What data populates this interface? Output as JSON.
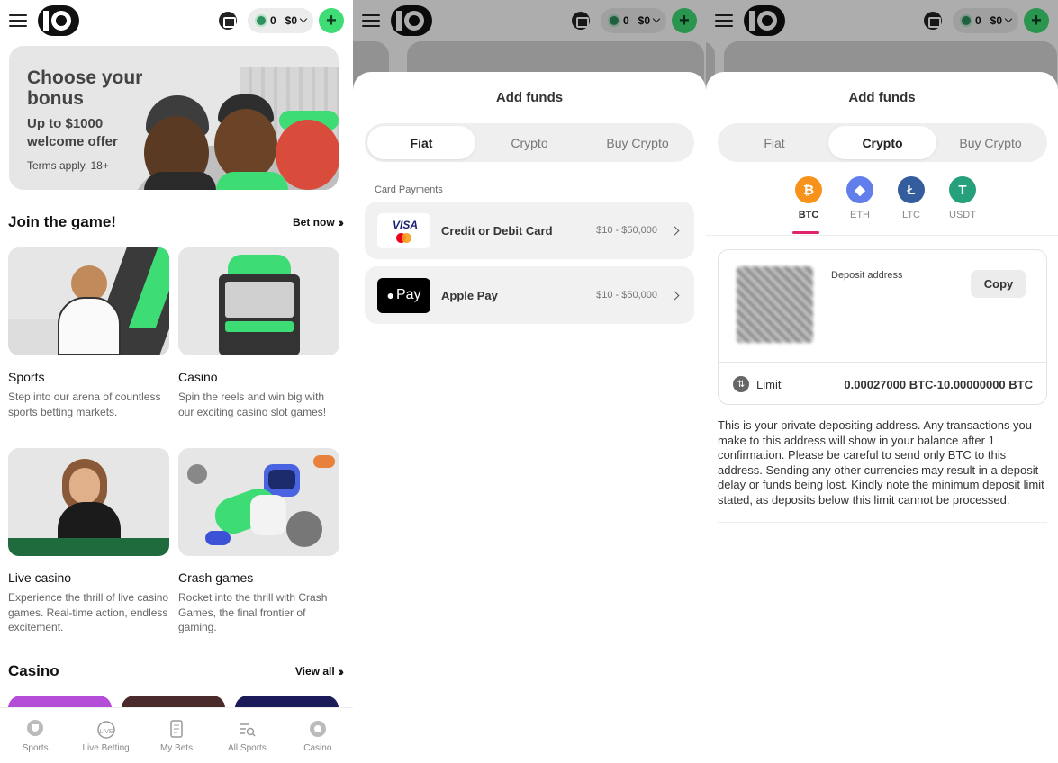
{
  "topbar": {
    "coins": "0",
    "balance": "$0",
    "plus": "+"
  },
  "home": {
    "promo": {
      "title": "Choose your bonus",
      "subtitle": "Up to $1000 welcome offer",
      "terms": "Terms apply, 18+"
    },
    "join": {
      "title": "Join the game!",
      "link": "Bet now"
    },
    "cards": [
      {
        "title": "Sports",
        "desc": "Step into our arena of countless sports betting markets."
      },
      {
        "title": "Casino",
        "desc": "Spin the reels and win big with our exciting casino slot games!"
      },
      {
        "title": "Live casino",
        "desc": "Experience the thrill of live casino games. Real-time action, endless excitement."
      },
      {
        "title": "Crash games",
        "desc": "Rocket into the thrill with Crash Games, the final frontier of gaming."
      }
    ],
    "casino": {
      "title": "Casino",
      "link": "View all"
    }
  },
  "bottom_nav": [
    {
      "label": "Sports",
      "icon": "trophy-icon"
    },
    {
      "label": "Live Betting",
      "icon": "live-stopwatch-icon"
    },
    {
      "label": "My Bets",
      "icon": "receipt-icon"
    },
    {
      "label": "All Sports",
      "icon": "list-search-icon"
    },
    {
      "label": "Casino",
      "icon": "casino-chip-icon"
    }
  ],
  "add_funds": {
    "title": "Add funds",
    "tabs": [
      "Fiat",
      "Crypto",
      "Buy Crypto"
    ],
    "fiat": {
      "section_label": "Card Payments",
      "methods": [
        {
          "name": "Credit or Debit Card",
          "range": "$10 - $50,000",
          "logo_text": "VISA"
        },
        {
          "name": "Apple Pay",
          "range": "$10 - $50,000",
          "logo_text": "Pay"
        }
      ]
    },
    "crypto": {
      "currencies": [
        {
          "code": "BTC",
          "symbol": "₿",
          "color": "#f7931a"
        },
        {
          "code": "ETH",
          "symbol": "◆",
          "color": "#627eea"
        },
        {
          "code": "LTC",
          "symbol": "Ł",
          "color": "#345d9d"
        },
        {
          "code": "USDT",
          "symbol": "T",
          "color": "#26a17b"
        }
      ],
      "selected": "BTC",
      "deposit_label": "Deposit address",
      "copy_label": "Copy",
      "limit_label": "Limit",
      "limit_value": "0.00027000 BTC-10.00000000 BTC",
      "info": "This is your private depositing address. Any transactions you make to this address will show in your balance after 1 confirmation. Please be careful to send only BTC to this address. Sending any other currencies may result in a deposit delay or funds being lost. Kindly note the minimum deposit limit stated, as deposits below this limit cannot be processed."
    }
  },
  "colors": {
    "accent_green": "#3ddc74",
    "active_underline": "#e0246b"
  }
}
